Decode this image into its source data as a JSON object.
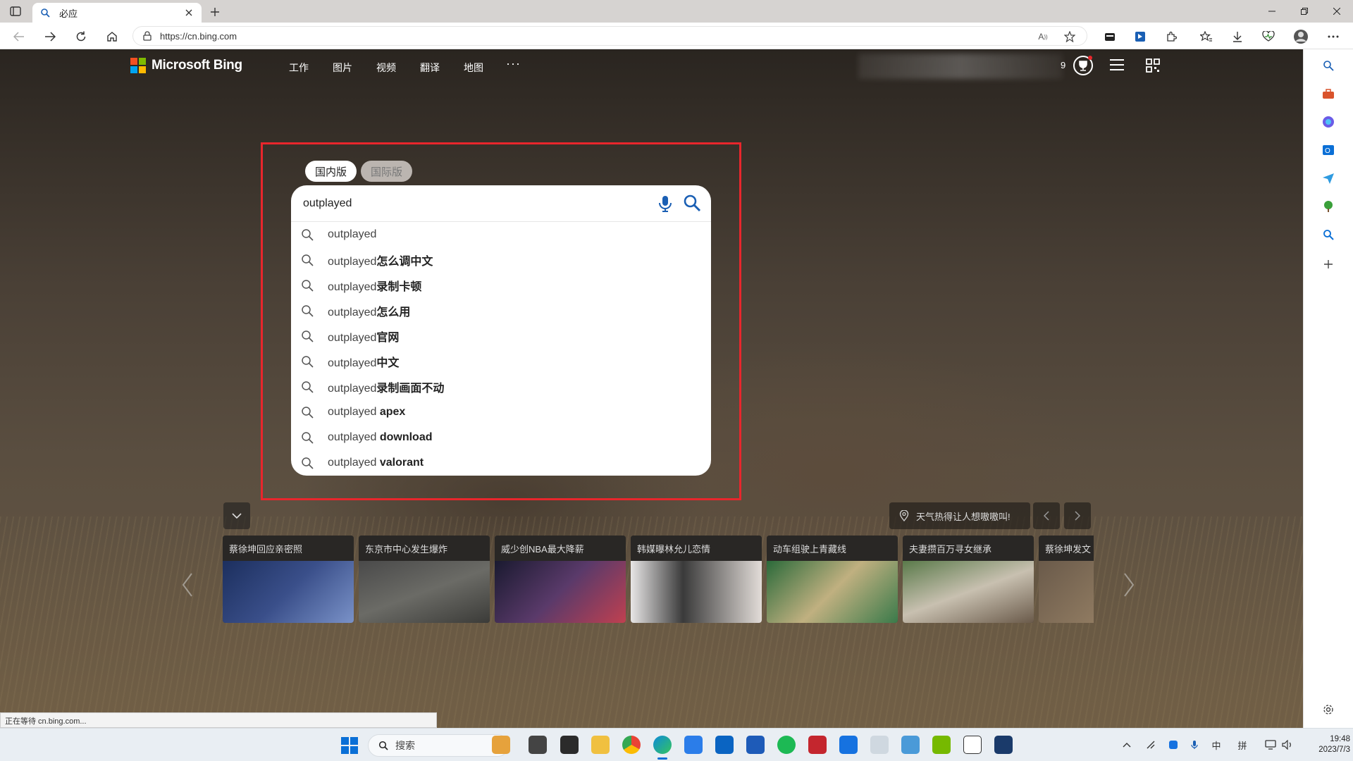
{
  "browser": {
    "tab_title": "必应",
    "url": "https://cn.bing.com",
    "status_text": "正在等待 cn.bing.com..."
  },
  "bing": {
    "logo_text": "Microsoft Bing",
    "nav": [
      "工作",
      "图片",
      "视频",
      "翻译",
      "地图"
    ],
    "nav_more": "···",
    "reward_points": "9",
    "version_tabs": {
      "domestic": "国内版",
      "international": "国际版"
    },
    "search": {
      "query": "outplayed",
      "suggestions": [
        {
          "prefix": "outplayed",
          "bold": ""
        },
        {
          "prefix": "outplayed",
          "bold": "怎么调中文"
        },
        {
          "prefix": "outplayed",
          "bold": "录制卡顿"
        },
        {
          "prefix": "outplayed",
          "bold": "怎么用"
        },
        {
          "prefix": "outplayed",
          "bold": "官网"
        },
        {
          "prefix": "outplayed",
          "bold": "中文"
        },
        {
          "prefix": "outplayed",
          "bold": "录制画面不动"
        },
        {
          "prefix": "outplayed ",
          "bold": "apex"
        },
        {
          "prefix": "outplayed ",
          "bold": "download"
        },
        {
          "prefix": "outplayed ",
          "bold": "valorant"
        }
      ]
    },
    "hot_banner": "天气热得让人想嗷嗷叫!",
    "news": [
      {
        "caption": "蔡徐坤回应亲密照"
      },
      {
        "caption": "东京市中心发生爆炸"
      },
      {
        "caption": "威少创NBA最大降薪"
      },
      {
        "caption": "韩媒曝林允儿恋情"
      },
      {
        "caption": "动车组驶上青藏线"
      },
      {
        "caption": "夫妻攒百万寻女继承"
      },
      {
        "caption": "蔡徐坤发文"
      }
    ]
  },
  "taskbar": {
    "search_label": "搜索",
    "ime_lang": "中",
    "ime_mode": "拼",
    "time": "19:48",
    "date": "2023/7/3"
  },
  "colors": {
    "highlight_frame": "#e8262c",
    "ms_red": "#f25022",
    "ms_green": "#7fba00",
    "ms_blue": "#00a4ef",
    "ms_yellow": "#ffb900"
  }
}
